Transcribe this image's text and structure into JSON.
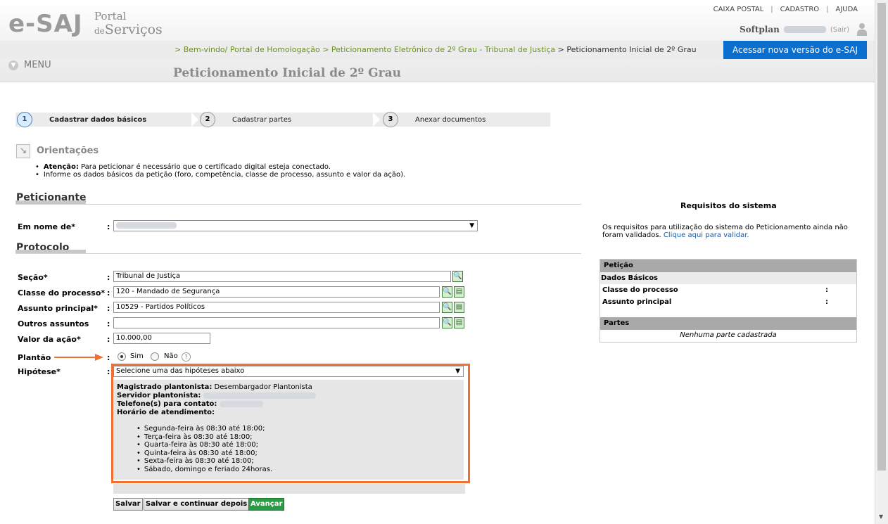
{
  "header": {
    "logo_main": "e-SAJ",
    "logo_portal": "Portal",
    "logo_de": "de",
    "logo_servicos": "Serviços",
    "top_links": [
      "CAIXA POSTAL",
      "CADASTRO",
      "AJUDA"
    ],
    "user_name": "Softplan",
    "logout": "(Sair)",
    "menu": "MENU",
    "new_version": "Acessar nova versão do e-SAJ"
  },
  "breadcrumb": {
    "items": [
      "> Bem-vindo/ Portal de Homologação",
      "> Peticionamento Eletrônico de 2º Grau - Tribunal de Justiça"
    ],
    "current": "> Peticionamento Inicial de 2º Grau"
  },
  "page_title": "Peticionamento Inicial de 2º Grau",
  "wizard": [
    {
      "num": "1",
      "label": "Cadastrar dados básicos"
    },
    {
      "num": "2",
      "label": "Cadastrar partes"
    },
    {
      "num": "3",
      "label": "Anexar documentos"
    }
  ],
  "orientacoes": {
    "title": "Orientações",
    "item1_strong": "Atenção:",
    "item1_text": " Para peticionar é necessário que o certificado digital esteja conectado.",
    "item2": "Informe os dados básicos da petição (foro, competência, classe de processo, assunto e valor da ação)."
  },
  "peticionante": {
    "title": "Peticionante",
    "em_nome_label": "Em nome de*"
  },
  "protocolo": {
    "title": "Protocolo",
    "secao_label": "Seção*",
    "secao_value": "Tribunal de Justiça",
    "classe_label": "Classe do processo*",
    "classe_value": "120 - Mandado de Segurança",
    "assunto_label": "Assunto principal*",
    "assunto_value": "10529 - Partidos Políticos",
    "outros_label": "Outros assuntos",
    "outros_value": "",
    "valor_label": "Valor da ação*",
    "valor_value": "10.000,00",
    "plantao_label": "Plantão",
    "sim": "Sim",
    "nao": "Não",
    "hipotese_label": "Hipótese*",
    "hipotese_value": "Selecione uma das hipóteses abaixo",
    "colon": ":"
  },
  "plantao_info": {
    "magistrado_label": "Magistrado plantonista:",
    "magistrado_value": " Desembargador Plantonista",
    "servidor_label": "Servidor plantonista:",
    "telefone_label": "Telefone(s) para contato:",
    "horario_label": "Horário de atendimento:",
    "hours": [
      "Segunda-feira às 08:30 até 18:00;",
      "Terça-feira às 08:30 até 18:00;",
      "Quarta-feira às 08:30 até 18:00;",
      "Quinta-feira às 08:30 até 18:00;",
      "Sexta-feira às 08:30 até 18:00;",
      "Sábado, domingo e feriado 24horas."
    ]
  },
  "buttons": {
    "salvar": "Salvar",
    "salvar_continuar": "Salvar e continuar depois",
    "avancar": "Avançar"
  },
  "requisitos": {
    "title": "Requisitos do sistema",
    "text": "Os requisitos para utilização do sistema do Peticionamento ainda não foram validados. ",
    "link": "Clique aqui para validar."
  },
  "summary": {
    "peticao": "Petição",
    "dados_basicos": "Dados Básicos",
    "classe": "Classe do processo",
    "assunto": "Assunto principal",
    "colon": ":",
    "partes": "Partes",
    "nenhuma": "Nenhuma parte cadastrada"
  },
  "colors": {
    "accent_blue": "#0a6fce",
    "breadcrumb_green": "#6c8f2a",
    "highlight_orange": "#f07030",
    "go_green": "#2a9a45"
  }
}
